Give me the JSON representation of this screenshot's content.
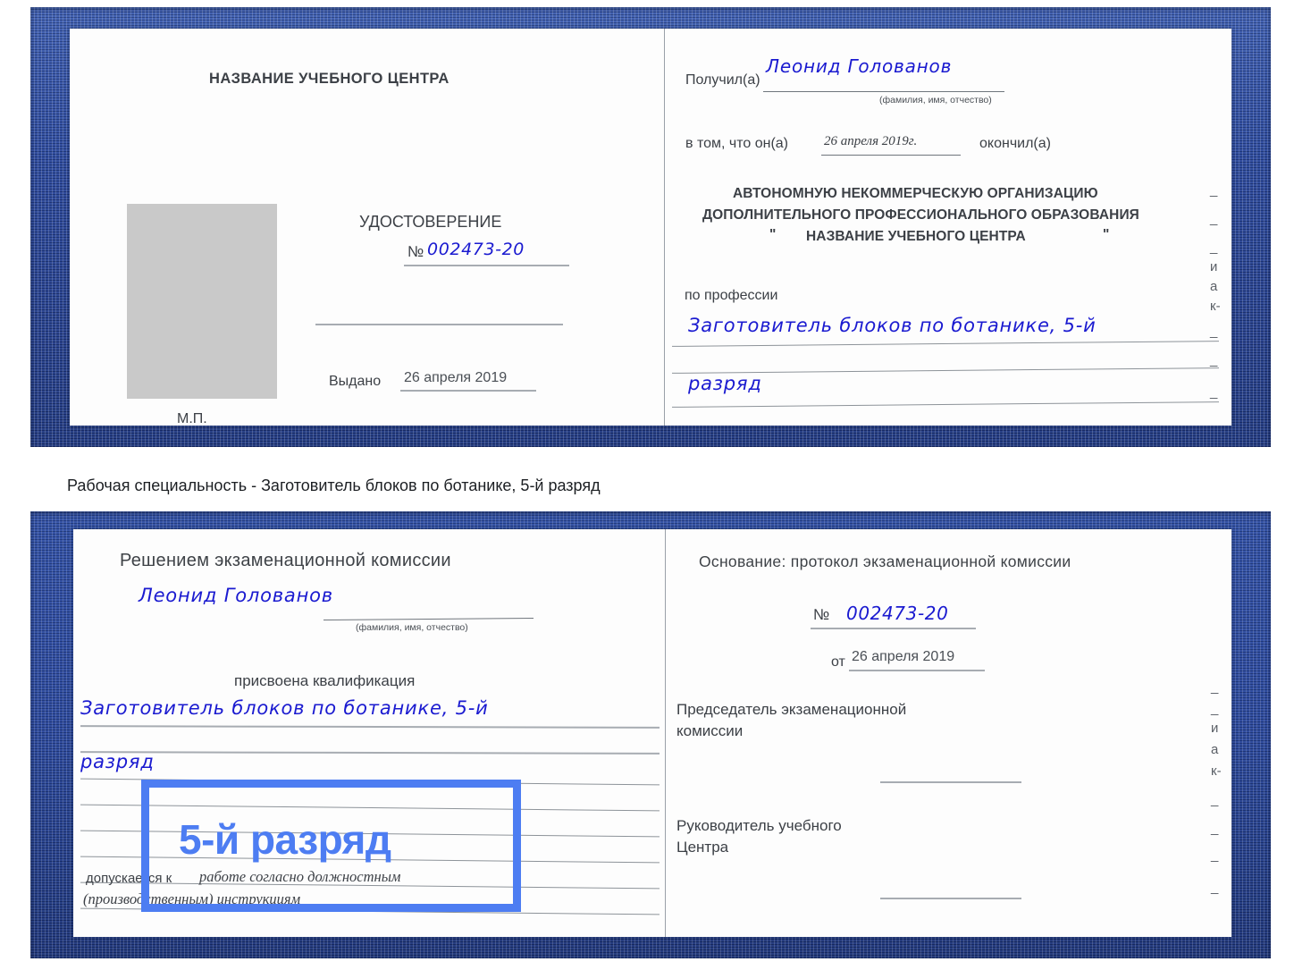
{
  "meta": {
    "accent_blue": "#4d7df2",
    "cover_blue": "#27459b",
    "ink_blue": "#1a1ad0",
    "photo_gray": "#c9c9c9"
  },
  "caption": {
    "text": "Рабочая специальность - Заготовитель блоков по ботанике, 5-й разряд"
  },
  "highlight": {
    "label": "5-й разряд"
  },
  "certificate_top": {
    "left_page": {
      "center_name": "НАЗВАНИЕ УЧЕБНОГО ЦЕНТРА",
      "doc_title": "УДОСТОВЕРЕНИЕ",
      "number_symbol": "№",
      "number_value": "002473-20",
      "issued_label": "Выдано",
      "issued_value": "26 апреля 2019",
      "stamp_label": "М.П."
    },
    "right_page": {
      "received_label": "Получил(а)",
      "received_value": "Леонид Голованов",
      "fio_hint": "(фамилия, имя, отчество)",
      "in_that_label": "в том, что он(а)",
      "completed_date": "26 апреля 2019г.",
      "completed_label": "окончил(а)",
      "org_line1": "АВТОНОМНУЮ НЕКОММЕРЧЕСКУЮ ОРГАНИЗАЦИЮ",
      "org_line2": "ДОПОЛНИТЕЛЬНОГО ПРОФЕССИОНАЛЬНОГО ОБРАЗОВАНИЯ",
      "org_quote_open": "\"",
      "org_line3": "НАЗВАНИЕ УЧЕБНОГО ЦЕНТРА",
      "org_quote_close": "\"",
      "profession_label": "по профессии",
      "profession_value_line1": "Заготовитель блоков по ботанике, 5-й",
      "profession_value_line2": "разряд"
    },
    "edge_fragments": [
      "_",
      "_",
      "_",
      "и",
      "а",
      "к-",
      "_",
      "_",
      "_"
    ]
  },
  "certificate_bottom": {
    "left_page": {
      "decision_title": "Решением экзаменационной комиссии",
      "name_value": "Леонид Голованов",
      "fio_hint": "(фамилия, имя, отчество)",
      "qualification_label": "присвоена квалификация",
      "qualification_line1": "Заготовитель блоков по ботанике, 5-й",
      "qualification_line2": "разряд",
      "allowed_label": "допускается к",
      "allowed_value_line1": "работе согласно должностным",
      "allowed_value_line2": "(производственным) инструкциям"
    },
    "right_page": {
      "basis_label": "Основание: протокол экзаменационной комиссии",
      "number_symbol": "№",
      "number_value": "002473-20",
      "from_label": "от",
      "from_value": "26 апреля 2019",
      "chair_line1": "Председатель экзаменационной",
      "chair_line2": "комиссии",
      "head_line1": "Руководитель учебного",
      "head_line2": "Центра"
    },
    "edge_fragments": [
      "_",
      "_",
      "и",
      "а",
      "к-",
      "_",
      "_",
      "_",
      "_"
    ]
  }
}
